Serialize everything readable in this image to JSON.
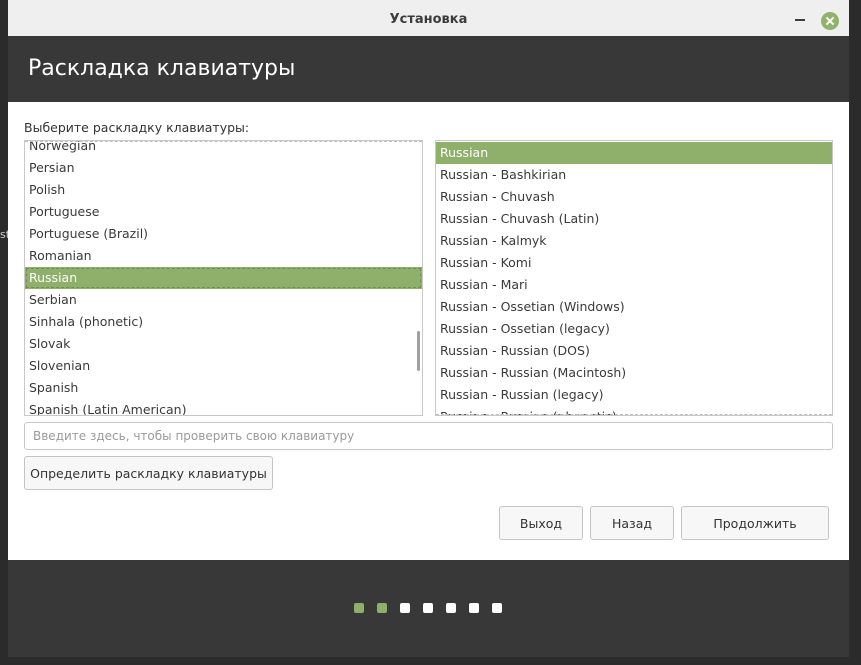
{
  "window": {
    "title": "Установка"
  },
  "header": {
    "heading": "Раскладка клавиатуры"
  },
  "layout_prompt": "Выберите раскладку клавиатуры:",
  "layouts": {
    "items": [
      "Norwegian",
      "Persian",
      "Polish",
      "Portuguese",
      "Portuguese (Brazil)",
      "Romanian",
      "Russian",
      "Serbian",
      "Sinhala (phonetic)",
      "Slovak",
      "Slovenian",
      "Spanish",
      "Spanish (Latin American)"
    ],
    "selected": "Russian"
  },
  "variants": {
    "items": [
      "Russian",
      "Russian - Bashkirian",
      "Russian - Chuvash",
      "Russian - Chuvash (Latin)",
      "Russian - Kalmyk",
      "Russian - Komi",
      "Russian - Mari",
      "Russian - Ossetian (Windows)",
      "Russian - Ossetian (legacy)",
      "Russian - Russian (DOS)",
      "Russian - Russian (Macintosh)",
      "Russian - Russian (legacy)",
      "Russian - Russian (phonetic)"
    ],
    "selected": "Russian"
  },
  "test_input": {
    "placeholder": "Введите здесь, чтобы проверить свою клавиатуру",
    "value": ""
  },
  "buttons": {
    "detect": "Определить раскладку клавиатуры",
    "quit": "Выход",
    "back": "Назад",
    "continue": "Продолжить"
  },
  "progress": {
    "total_steps": 7,
    "completed_steps": 2
  },
  "colors": {
    "accent": "#8fb06a",
    "header_bg": "#383838"
  }
}
